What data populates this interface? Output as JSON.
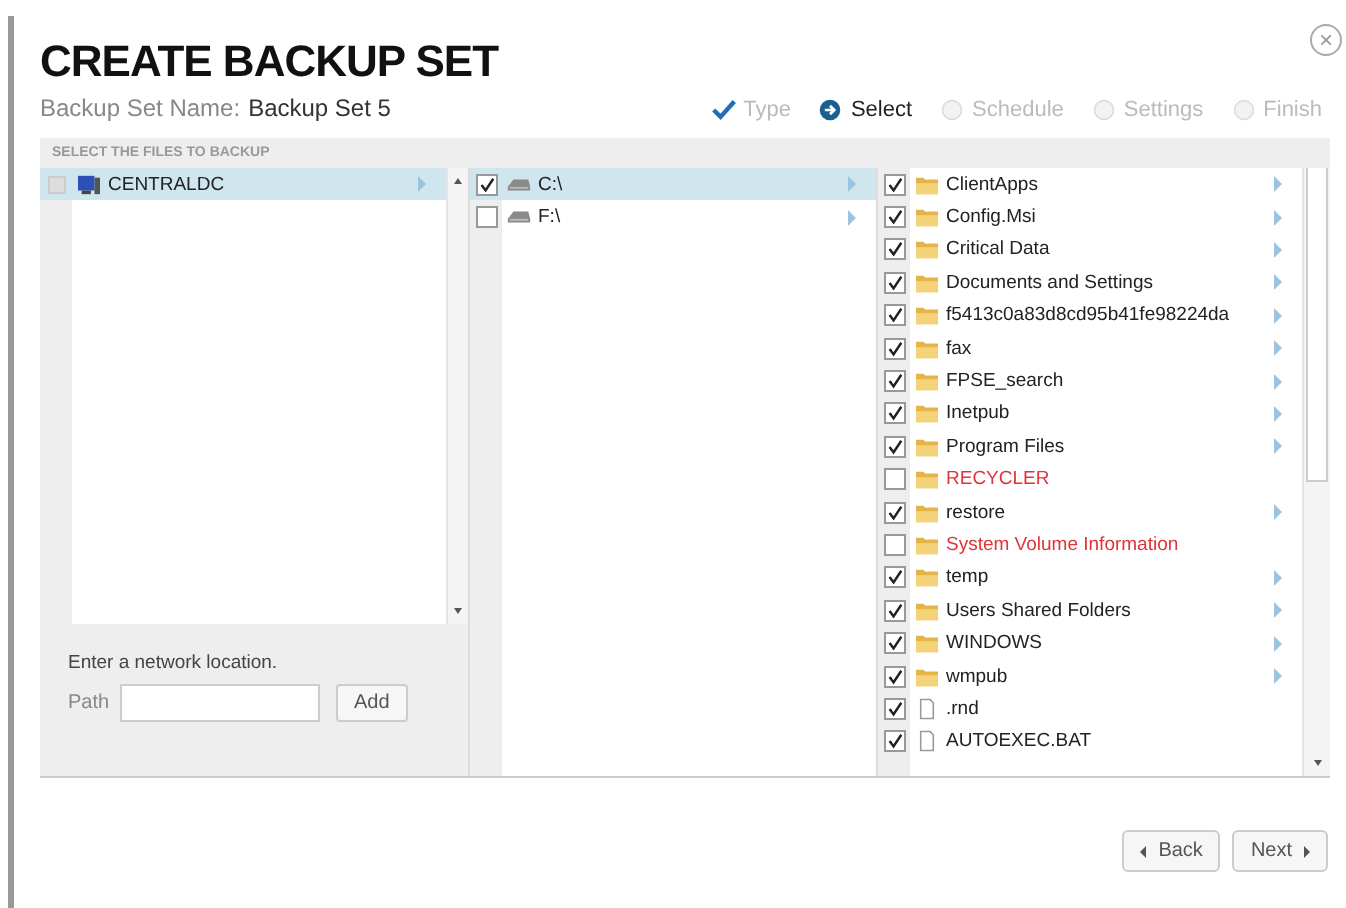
{
  "dialog": {
    "title": "CREATE BACKUP SET",
    "close": "×",
    "name_label": "Backup Set Name:",
    "name_value": "Backup Set 5"
  },
  "steps": [
    {
      "label": "Type",
      "kind": "done",
      "selected": false
    },
    {
      "label": "Select",
      "kind": "current",
      "selected": true
    },
    {
      "label": "Schedule",
      "kind": "pending",
      "selected": false
    },
    {
      "label": "Settings",
      "kind": "pending",
      "selected": false
    },
    {
      "label": "Finish",
      "kind": "pending",
      "selected": false
    }
  ],
  "section_title": "SELECT THE FILES TO BACKUP",
  "computers": [
    {
      "name": "CENTRALDC",
      "selected": true
    }
  ],
  "drives": [
    {
      "name": "C:\\",
      "checked": true,
      "selected": true
    },
    {
      "name": "F:\\",
      "checked": false,
      "selected": false
    }
  ],
  "files": [
    {
      "name": "ClientApps",
      "kind": "folder",
      "checked": true,
      "excluded": false,
      "expandable": true
    },
    {
      "name": "Config.Msi",
      "kind": "folder",
      "checked": true,
      "excluded": false,
      "expandable": true
    },
    {
      "name": "Critical Data",
      "kind": "folder",
      "checked": true,
      "excluded": false,
      "expandable": true
    },
    {
      "name": "Documents and Settings",
      "kind": "folder",
      "checked": true,
      "excluded": false,
      "expandable": true
    },
    {
      "name": "f5413c0a83d8cd95b41fe98224da",
      "kind": "folder",
      "checked": true,
      "excluded": false,
      "expandable": true
    },
    {
      "name": "fax",
      "kind": "folder",
      "checked": true,
      "excluded": false,
      "expandable": true
    },
    {
      "name": "FPSE_search",
      "kind": "folder",
      "checked": true,
      "excluded": false,
      "expandable": true
    },
    {
      "name": "Inetpub",
      "kind": "folder",
      "checked": true,
      "excluded": false,
      "expandable": true
    },
    {
      "name": "Program Files",
      "kind": "folder",
      "checked": true,
      "excluded": false,
      "expandable": true
    },
    {
      "name": "RECYCLER",
      "kind": "folder",
      "checked": false,
      "excluded": true,
      "expandable": false
    },
    {
      "name": "restore",
      "kind": "folder",
      "checked": true,
      "excluded": false,
      "expandable": true
    },
    {
      "name": "System Volume Information",
      "kind": "folder",
      "checked": false,
      "excluded": true,
      "expandable": false
    },
    {
      "name": "temp",
      "kind": "folder",
      "checked": true,
      "excluded": false,
      "expandable": true
    },
    {
      "name": "Users Shared Folders",
      "kind": "folder",
      "checked": true,
      "excluded": false,
      "expandable": true
    },
    {
      "name": "WINDOWS",
      "kind": "folder",
      "checked": true,
      "excluded": false,
      "expandable": true
    },
    {
      "name": "wmpub",
      "kind": "folder",
      "checked": true,
      "excluded": false,
      "expandable": true
    },
    {
      "name": ".rnd",
      "kind": "file",
      "checked": true,
      "excluded": false,
      "expandable": false
    },
    {
      "name": "AUTOEXEC.BAT",
      "kind": "file",
      "checked": true,
      "excluded": false,
      "expandable": false
    }
  ],
  "network": {
    "prompt": "Enter a network location.",
    "path_label": "Path",
    "add_button": "Add"
  },
  "buttons": {
    "back": "Back",
    "next": "Next"
  }
}
